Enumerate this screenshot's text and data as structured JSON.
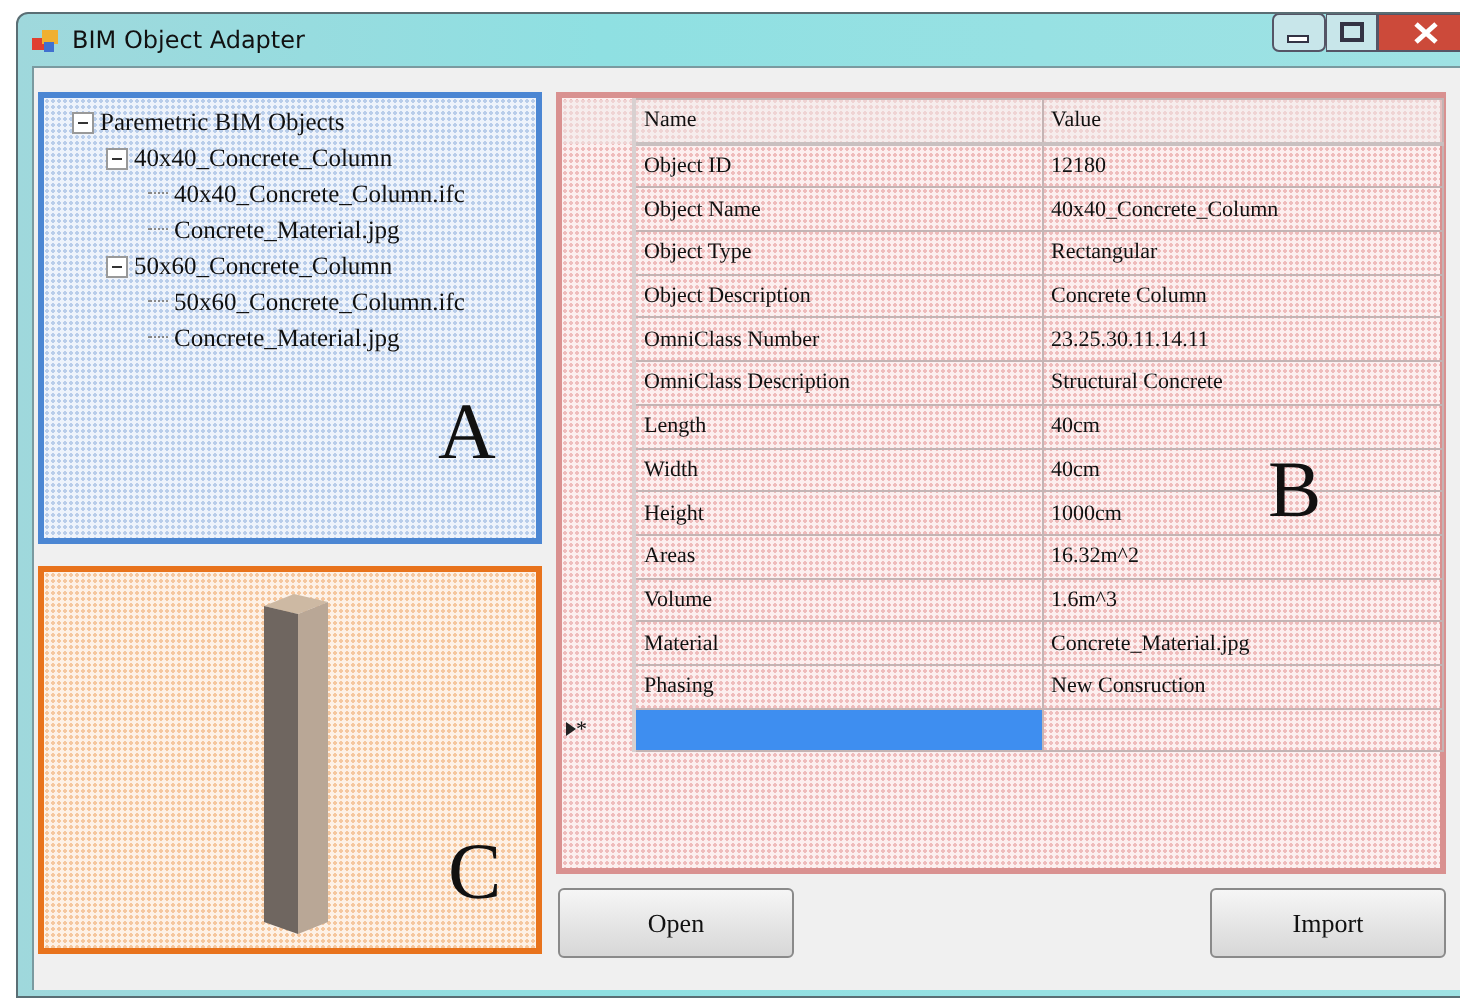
{
  "window": {
    "title": "BIM Object Adapter"
  },
  "tree": {
    "panel_label": "A",
    "root": {
      "label": "Paremetric BIM Objects",
      "expanded": true,
      "children": [
        {
          "label": "40x40_Concrete_Column",
          "expanded": true,
          "children": [
            {
              "label": "40x40_Concrete_Column.ifc"
            },
            {
              "label": "Concrete_Material.jpg"
            }
          ]
        },
        {
          "label": "50x60_Concrete_Column",
          "expanded": true,
          "children": [
            {
              "label": "50x60_Concrete_Column.ifc"
            },
            {
              "label": "Concrete_Material.jpg"
            }
          ]
        }
      ]
    }
  },
  "properties": {
    "panel_label": "B",
    "columns": [
      "Name",
      "Value"
    ],
    "rows": [
      {
        "name": "Object ID",
        "value": "12180"
      },
      {
        "name": "Object Name",
        "value": "40x40_Concrete_Column"
      },
      {
        "name": "Object Type",
        "value": "Rectangular"
      },
      {
        "name": "Object Description",
        "value": "Concrete Column"
      },
      {
        "name": "OmniClass Number",
        "value": "23.25.30.11.14.11"
      },
      {
        "name": "OmniClass Description",
        "value": "Structural Concrete"
      },
      {
        "name": "Length",
        "value": "40cm"
      },
      {
        "name": "Width",
        "value": "40cm"
      },
      {
        "name": "Height",
        "value": "1000cm"
      },
      {
        "name": "Areas",
        "value": "16.32m^2"
      },
      {
        "name": "Volume",
        "value": "1.6m^3"
      },
      {
        "name": "Material",
        "value": "Concrete_Material.jpg"
      },
      {
        "name": "Phasing",
        "value": "New Consruction"
      }
    ],
    "new_row": {
      "marker": "*",
      "selected": true
    }
  },
  "preview": {
    "panel_label": "C"
  },
  "buttons": [
    "Open",
    "Import"
  ]
}
